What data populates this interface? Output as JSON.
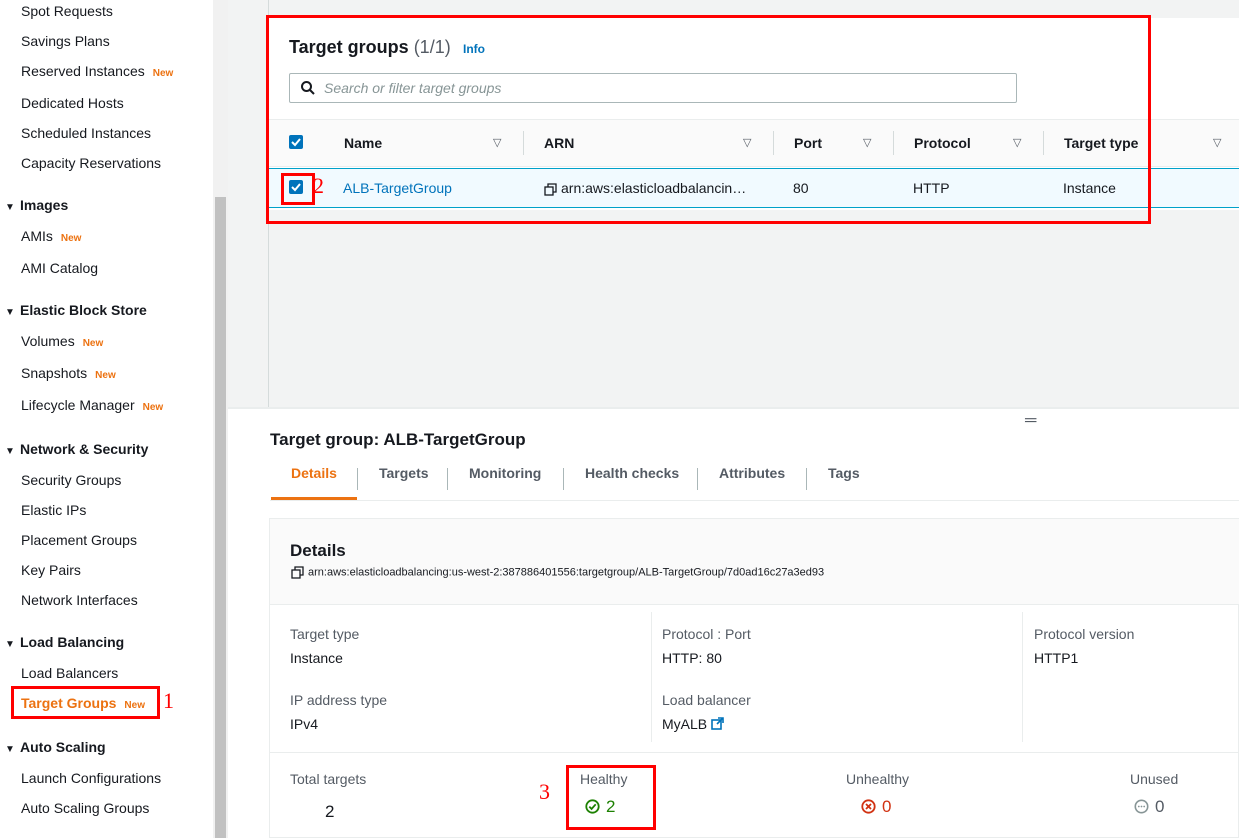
{
  "sidebar": {
    "items_top": [
      {
        "label": "Spot Requests"
      },
      {
        "label": "Savings Plans"
      },
      {
        "label": "Reserved Instances",
        "badge": "New"
      },
      {
        "label": "Dedicated Hosts"
      },
      {
        "label": "Scheduled Instances"
      },
      {
        "label": "Capacity Reservations"
      }
    ],
    "images": {
      "title": "Images",
      "items": [
        {
          "label": "AMIs",
          "badge": "New"
        },
        {
          "label": "AMI Catalog"
        }
      ]
    },
    "ebs": {
      "title": "Elastic Block Store",
      "items": [
        {
          "label": "Volumes",
          "badge": "New"
        },
        {
          "label": "Snapshots",
          "badge": "New"
        },
        {
          "label": "Lifecycle Manager",
          "badge": "New"
        }
      ]
    },
    "network": {
      "title": "Network & Security",
      "items": [
        {
          "label": "Security Groups"
        },
        {
          "label": "Elastic IPs"
        },
        {
          "label": "Placement Groups"
        },
        {
          "label": "Key Pairs"
        },
        {
          "label": "Network Interfaces"
        }
      ]
    },
    "lb": {
      "title": "Load Balancing",
      "items": [
        {
          "label": "Load Balancers"
        },
        {
          "label": "Target Groups",
          "badge": "New"
        }
      ]
    },
    "as": {
      "title": "Auto Scaling",
      "items": [
        {
          "label": "Launch Configurations"
        },
        {
          "label": "Auto Scaling Groups"
        }
      ]
    }
  },
  "target_groups": {
    "title": "Target groups",
    "count": "(1/1)",
    "info": "Info",
    "search_placeholder": "Search or filter target groups",
    "columns": [
      "Name",
      "ARN",
      "Port",
      "Protocol",
      "Target type"
    ],
    "rows": [
      {
        "name": "ALB-TargetGroup",
        "arn": "arn:aws:elasticloadbalancin…",
        "port": "80",
        "protocol": "HTTP",
        "target_type": "Instance"
      }
    ]
  },
  "annotations": {
    "a1": "1",
    "a2": "2",
    "a3": "3"
  },
  "detail": {
    "title": "Target group: ALB-TargetGroup",
    "tabs": [
      "Details",
      "Targets",
      "Monitoring",
      "Health checks",
      "Attributes",
      "Tags"
    ],
    "section_title": "Details",
    "arn": "arn:aws:elasticloadbalancing:us-west-2:387886401556:targetgroup/ALB-TargetGroup/7d0ad16c27a3ed93",
    "target_type_label": "Target type",
    "target_type_value": "Instance",
    "protocol_port_label": "Protocol : Port",
    "protocol_port_value": "HTTP: 80",
    "protocol_version_label": "Protocol version",
    "protocol_version_value": "HTTP1",
    "ip_type_label": "IP address type",
    "ip_type_value": "IPv4",
    "lb_label": "Load balancer",
    "lb_value": "MyALB",
    "total_label": "Total targets",
    "total_value": "2",
    "healthy_label": "Healthy",
    "healthy_value": "2",
    "unhealthy_label": "Unhealthy",
    "unhealthy_value": "0",
    "unused_label": "Unused",
    "unused_value": "0"
  },
  "colors": {
    "accent": "#ec7211",
    "link": "#0073bb",
    "healthy": "#1d8102",
    "unhealthy": "#d13212",
    "annotation": "#ff0000"
  }
}
